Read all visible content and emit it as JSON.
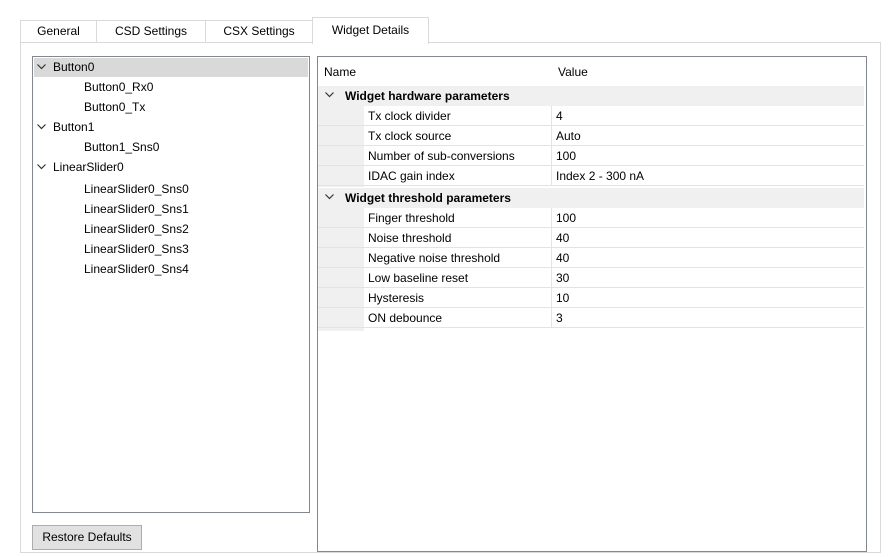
{
  "tabs": [
    {
      "label": "General",
      "active": false
    },
    {
      "label": "CSD Settings",
      "active": false
    },
    {
      "label": "CSX Settings",
      "active": false
    },
    {
      "label": "Widget Details",
      "active": true
    }
  ],
  "tree": {
    "items": [
      {
        "label": "Button0",
        "expandable": true,
        "selected": true
      },
      {
        "label": "Button0_Rx0"
      },
      {
        "label": "Button0_Tx"
      },
      {
        "label": "Button1",
        "expandable": true
      },
      {
        "label": "Button1_Sns0"
      },
      {
        "label": "LinearSlider0",
        "expandable": true
      },
      {
        "label": "LinearSlider0_Sns0"
      },
      {
        "label": "LinearSlider0_Sns1"
      },
      {
        "label": "LinearSlider0_Sns2"
      },
      {
        "label": "LinearSlider0_Sns3"
      },
      {
        "label": "LinearSlider0_Sns4"
      }
    ]
  },
  "restore_button": "Restore Defaults",
  "grid": {
    "header_name": "Name",
    "header_value": "Value",
    "sections": [
      {
        "title": "Widget hardware parameters",
        "rows": [
          {
            "name": "Tx clock divider",
            "value": "4"
          },
          {
            "name": "Tx clock source",
            "value": "Auto"
          },
          {
            "name": "Number of sub-conversions",
            "value": "100"
          },
          {
            "name": "IDAC gain index",
            "value": "Index 2 - 300 nA"
          }
        ]
      },
      {
        "title": "Widget threshold parameters",
        "rows": [
          {
            "name": "Finger threshold",
            "value": "100"
          },
          {
            "name": "Noise threshold",
            "value": "40"
          },
          {
            "name": "Negative noise threshold",
            "value": "40"
          },
          {
            "name": "Low baseline reset",
            "value": "30"
          },
          {
            "name": "Hysteresis",
            "value": "10"
          },
          {
            "name": "ON debounce",
            "value": "3"
          }
        ]
      }
    ]
  }
}
